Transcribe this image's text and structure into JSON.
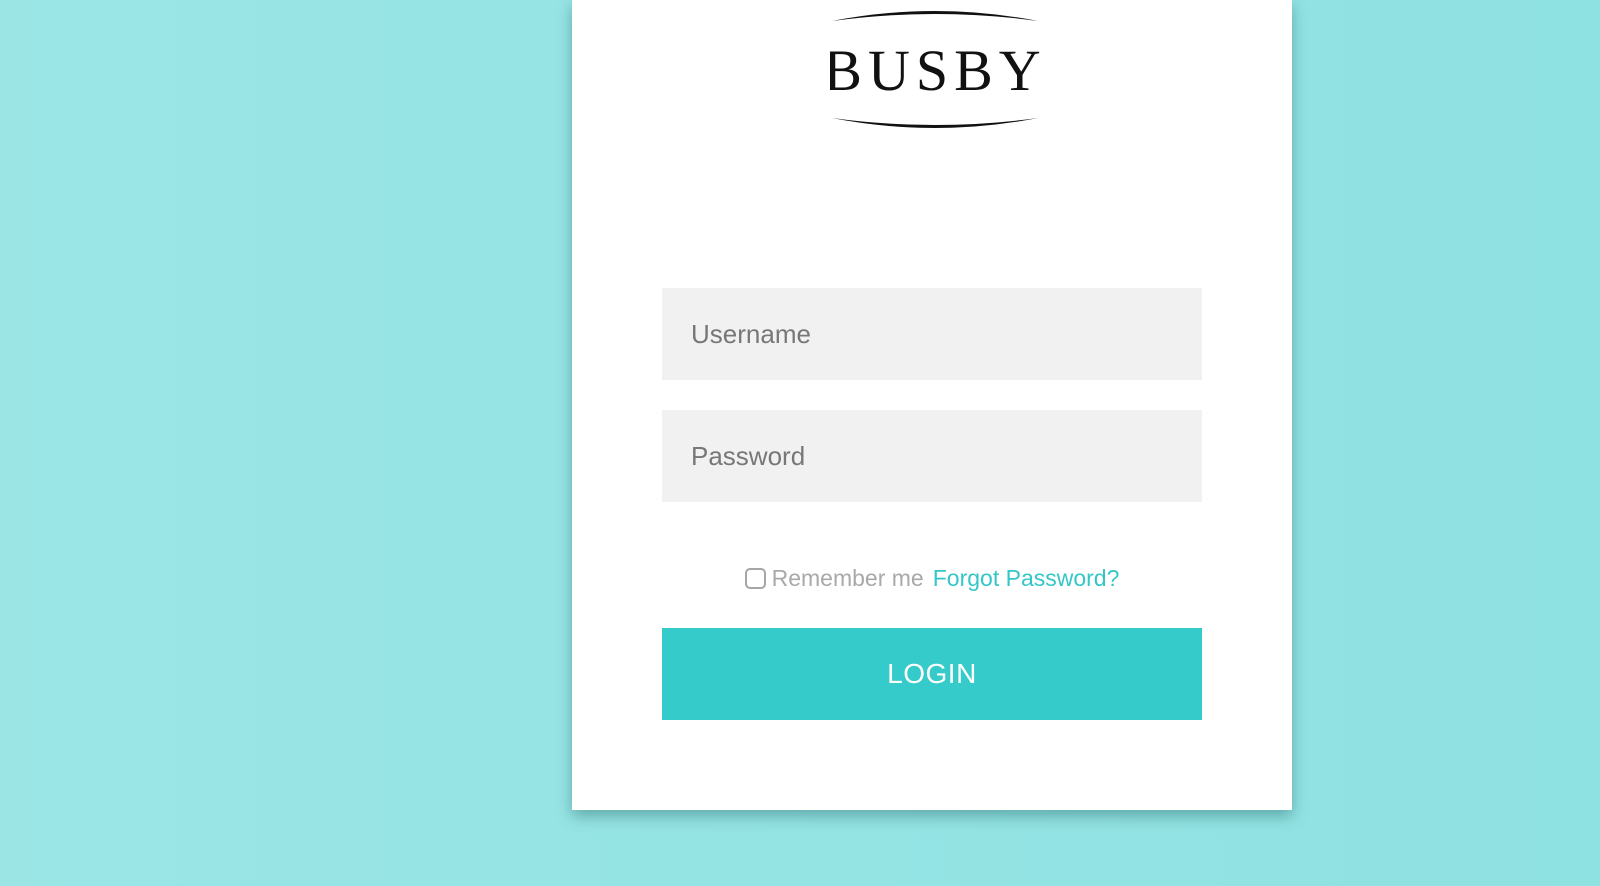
{
  "brand": {
    "logo_text": "BUSBY",
    "logo_icon": "busby-logo"
  },
  "form": {
    "username_placeholder": "Username",
    "password_placeholder": "Password",
    "remember_label": "Remember me",
    "remember_checked": false,
    "forgot_label": "Forgot Password?",
    "login_label": "LOGIN"
  },
  "colors": {
    "background": "#95e4e4",
    "card": "#ffffff",
    "input_bg": "#f1f1f1",
    "accent": "#36cbcb",
    "link": "#35c6c6",
    "muted_text": "#a9a9a9"
  }
}
